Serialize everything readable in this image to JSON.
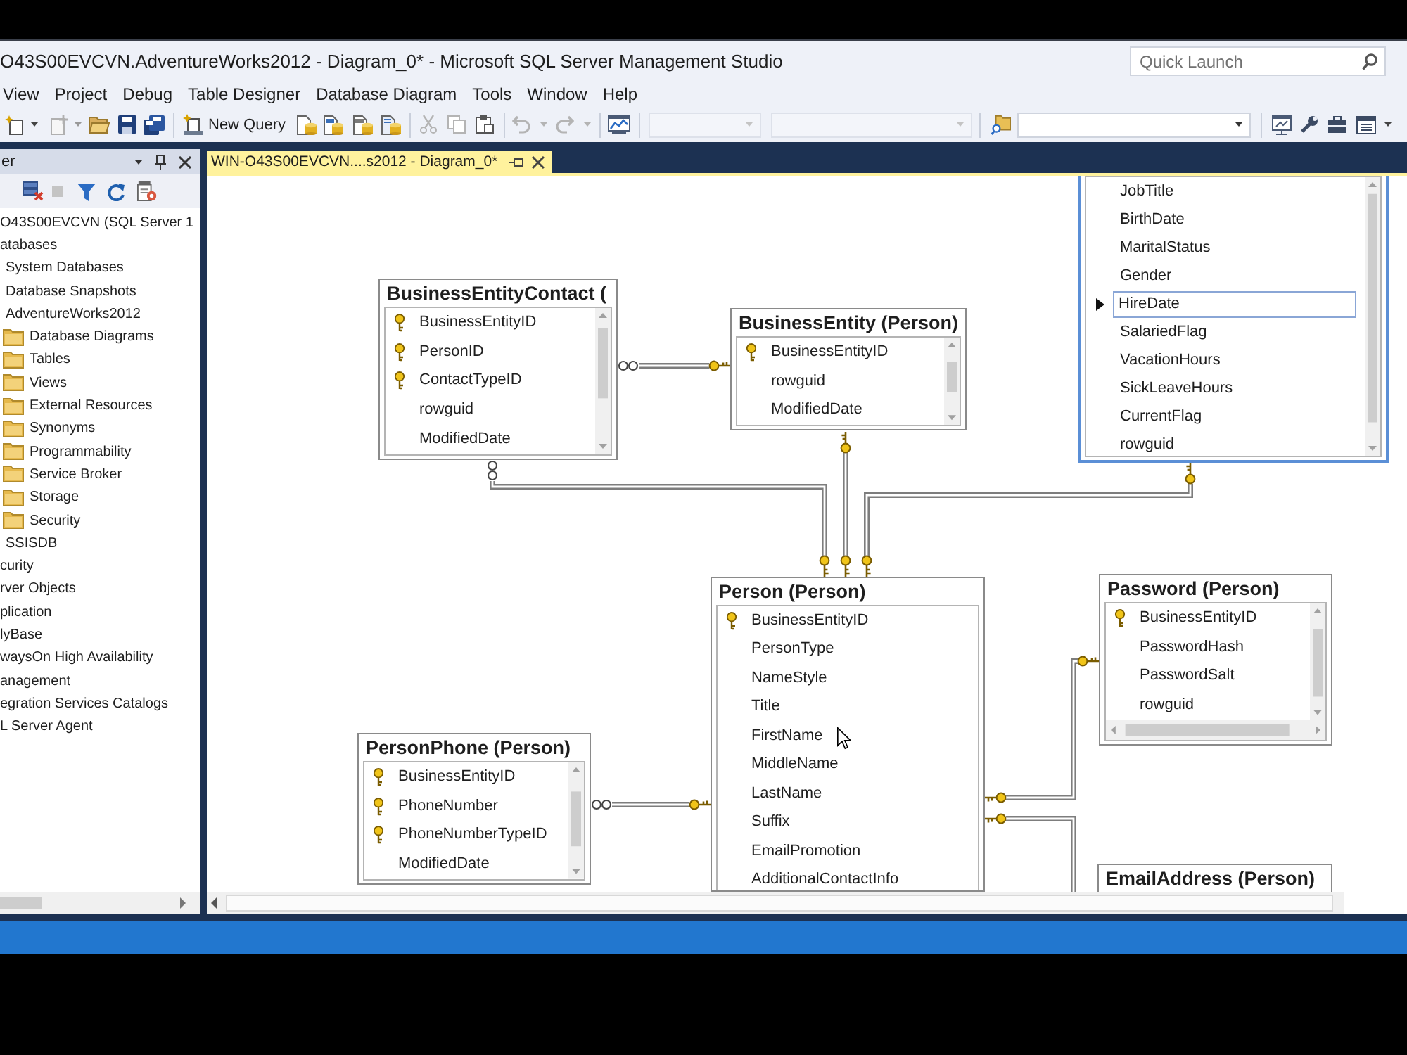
{
  "window": {
    "title": "O43S00EVCVN.AdventureWorks2012 - Diagram_0* - Microsoft SQL Server Management Studio"
  },
  "quick_launch": {
    "placeholder": "Quick Launch"
  },
  "menu": [
    {
      "label": "View"
    },
    {
      "label": "Project"
    },
    {
      "label": "Debug"
    },
    {
      "label": "Table Designer"
    },
    {
      "label": "Database Diagram"
    },
    {
      "label": "Tools"
    },
    {
      "label": "Window"
    },
    {
      "label": "Help"
    }
  ],
  "toolbar": {
    "new_query": "New Query"
  },
  "object_explorer": {
    "title": "er",
    "tree": [
      {
        "label": "O43S00EVCVN (SQL Server 1",
        "children": [
          {
            "label": "atabases",
            "children": [
              {
                "label": "System Databases"
              },
              {
                "label": "Database Snapshots"
              },
              {
                "label": "AdventureWorks2012",
                "children": [
                  {
                    "label": "Database Diagrams"
                  },
                  {
                    "label": "Tables"
                  },
                  {
                    "label": "Views"
                  },
                  {
                    "label": "External Resources"
                  },
                  {
                    "label": "Synonyms"
                  },
                  {
                    "label": "Programmability"
                  },
                  {
                    "label": "Service Broker"
                  },
                  {
                    "label": "Storage"
                  },
                  {
                    "label": "Security"
                  }
                ]
              },
              {
                "label": "SSISDB"
              }
            ]
          },
          {
            "label": "curity"
          },
          {
            "label": "rver Objects"
          },
          {
            "label": "plication"
          },
          {
            "label": "lyBase"
          },
          {
            "label": "waysOn High Availability"
          },
          {
            "label": "anagement"
          },
          {
            "label": "egration Services Catalogs"
          },
          {
            "label": "L Server Agent"
          }
        ]
      }
    ]
  },
  "document_tabs": [
    {
      "label": "WIN-O43S00EVCVN....s2012 - Diagram_0*",
      "selected": true
    }
  ],
  "diagram": {
    "tables": [
      {
        "title": "BusinessEntityContact (",
        "selected": false,
        "columns": [
          {
            "name": "BusinessEntityID",
            "key": true,
            "selected": false
          },
          {
            "name": "PersonID",
            "key": true,
            "selected": false
          },
          {
            "name": "ContactTypeID",
            "key": true,
            "selected": false
          },
          {
            "name": "rowguid",
            "key": false,
            "selected": false
          },
          {
            "name": "ModifiedDate",
            "key": false,
            "selected": false
          }
        ]
      },
      {
        "title": "BusinessEntity (Person)",
        "selected": false,
        "columns": [
          {
            "name": "BusinessEntityID",
            "key": true,
            "selected": false
          },
          {
            "name": "rowguid",
            "key": false,
            "selected": false
          },
          {
            "name": "ModifiedDate",
            "key": false,
            "selected": false
          }
        ]
      },
      {
        "selected": true,
        "columns": [
          {
            "name": "JobTitle",
            "key": false,
            "selected": false
          },
          {
            "name": "BirthDate",
            "key": false,
            "selected": false
          },
          {
            "name": "MaritalStatus",
            "key": false,
            "selected": false
          },
          {
            "name": "Gender",
            "key": false,
            "selected": false
          },
          {
            "name": "HireDate",
            "key": false,
            "selected": true
          },
          {
            "name": "SalariedFlag",
            "key": false,
            "selected": false
          },
          {
            "name": "VacationHours",
            "key": false,
            "selected": false
          },
          {
            "name": "SickLeaveHours",
            "key": false,
            "selected": false
          },
          {
            "name": "CurrentFlag",
            "key": false,
            "selected": false
          },
          {
            "name": "rowguid",
            "key": false,
            "selected": false
          }
        ]
      },
      {
        "title": "Person (Person)",
        "selected": false,
        "columns": [
          {
            "name": "BusinessEntityID",
            "key": true,
            "selected": false
          },
          {
            "name": "PersonType",
            "key": false,
            "selected": false
          },
          {
            "name": "NameStyle",
            "key": false,
            "selected": false
          },
          {
            "name": "Title",
            "key": false,
            "selected": false
          },
          {
            "name": "FirstName",
            "key": false,
            "selected": false
          },
          {
            "name": "MiddleName",
            "key": false,
            "selected": false
          },
          {
            "name": "LastName",
            "key": false,
            "selected": false
          },
          {
            "name": "Suffix",
            "key": false,
            "selected": false
          },
          {
            "name": "EmailPromotion",
            "key": false,
            "selected": false
          },
          {
            "name": "AdditionalContactInfo",
            "key": false,
            "selected": false
          }
        ]
      },
      {
        "title": "Password (Person)",
        "selected": false,
        "columns": [
          {
            "name": "BusinessEntityID",
            "key": true,
            "selected": false
          },
          {
            "name": "PasswordHash",
            "key": false,
            "selected": false
          },
          {
            "name": "PasswordSalt",
            "key": false,
            "selected": false
          },
          {
            "name": "rowguid",
            "key": false,
            "selected": false
          }
        ]
      },
      {
        "title": "PersonPhone (Person)",
        "selected": false,
        "columns": [
          {
            "name": "BusinessEntityID",
            "key": true,
            "selected": false
          },
          {
            "name": "PhoneNumber",
            "key": true,
            "selected": false
          },
          {
            "name": "PhoneNumberTypeID",
            "key": true,
            "selected": false
          },
          {
            "name": "ModifiedDate",
            "key": false,
            "selected": false
          }
        ]
      },
      {
        "title": "EmailAddress (Person)",
        "selected": false
      }
    ],
    "relationships": [
      {
        "ends": [
          {
            "kind": "many"
          },
          {
            "kind": "one"
          }
        ]
      },
      {
        "ends": [
          {
            "kind": "many"
          },
          {
            "kind": "one"
          }
        ]
      },
      {
        "ends": [
          {
            "kind": "one"
          },
          {
            "kind": "one"
          }
        ]
      },
      {
        "ends": [
          {
            "kind": "one"
          },
          {
            "kind": "one"
          }
        ]
      },
      {
        "ends": [
          {
            "kind": "many"
          },
          {
            "kind": "one"
          }
        ]
      },
      {
        "ends": [
          {
            "kind": "one"
          },
          {
            "kind": "one"
          }
        ]
      },
      {
        "ends": [
          {
            "kind": "one"
          }
        ]
      }
    ]
  }
}
